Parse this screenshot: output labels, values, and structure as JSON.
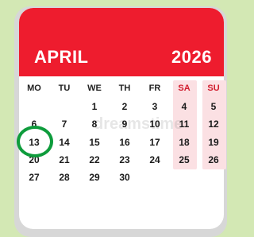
{
  "calendar": {
    "month": "APRIL",
    "year": "2026",
    "weekdays": [
      "MO",
      "TU",
      "WE",
      "TH",
      "FR",
      "SA",
      "SU"
    ],
    "weeks": [
      [
        "",
        "",
        "1",
        "2",
        "3",
        "4",
        "5"
      ],
      [
        "6",
        "7",
        "8",
        "9",
        "10",
        "11",
        "12"
      ],
      [
        "13",
        "14",
        "15",
        "16",
        "17",
        "18",
        "19"
      ],
      [
        "20",
        "21",
        "22",
        "23",
        "24",
        "25",
        "26"
      ],
      [
        "27",
        "28",
        "29",
        "30",
        "",
        "",
        ""
      ]
    ],
    "highlighted_day": "13",
    "colors": {
      "header": "#ee1c2e",
      "weekend_text": "#d11d2e",
      "weekend_band": "#fbe0e3",
      "highlight_ring": "#0e9c3c",
      "background": "#d3e8b4"
    }
  }
}
